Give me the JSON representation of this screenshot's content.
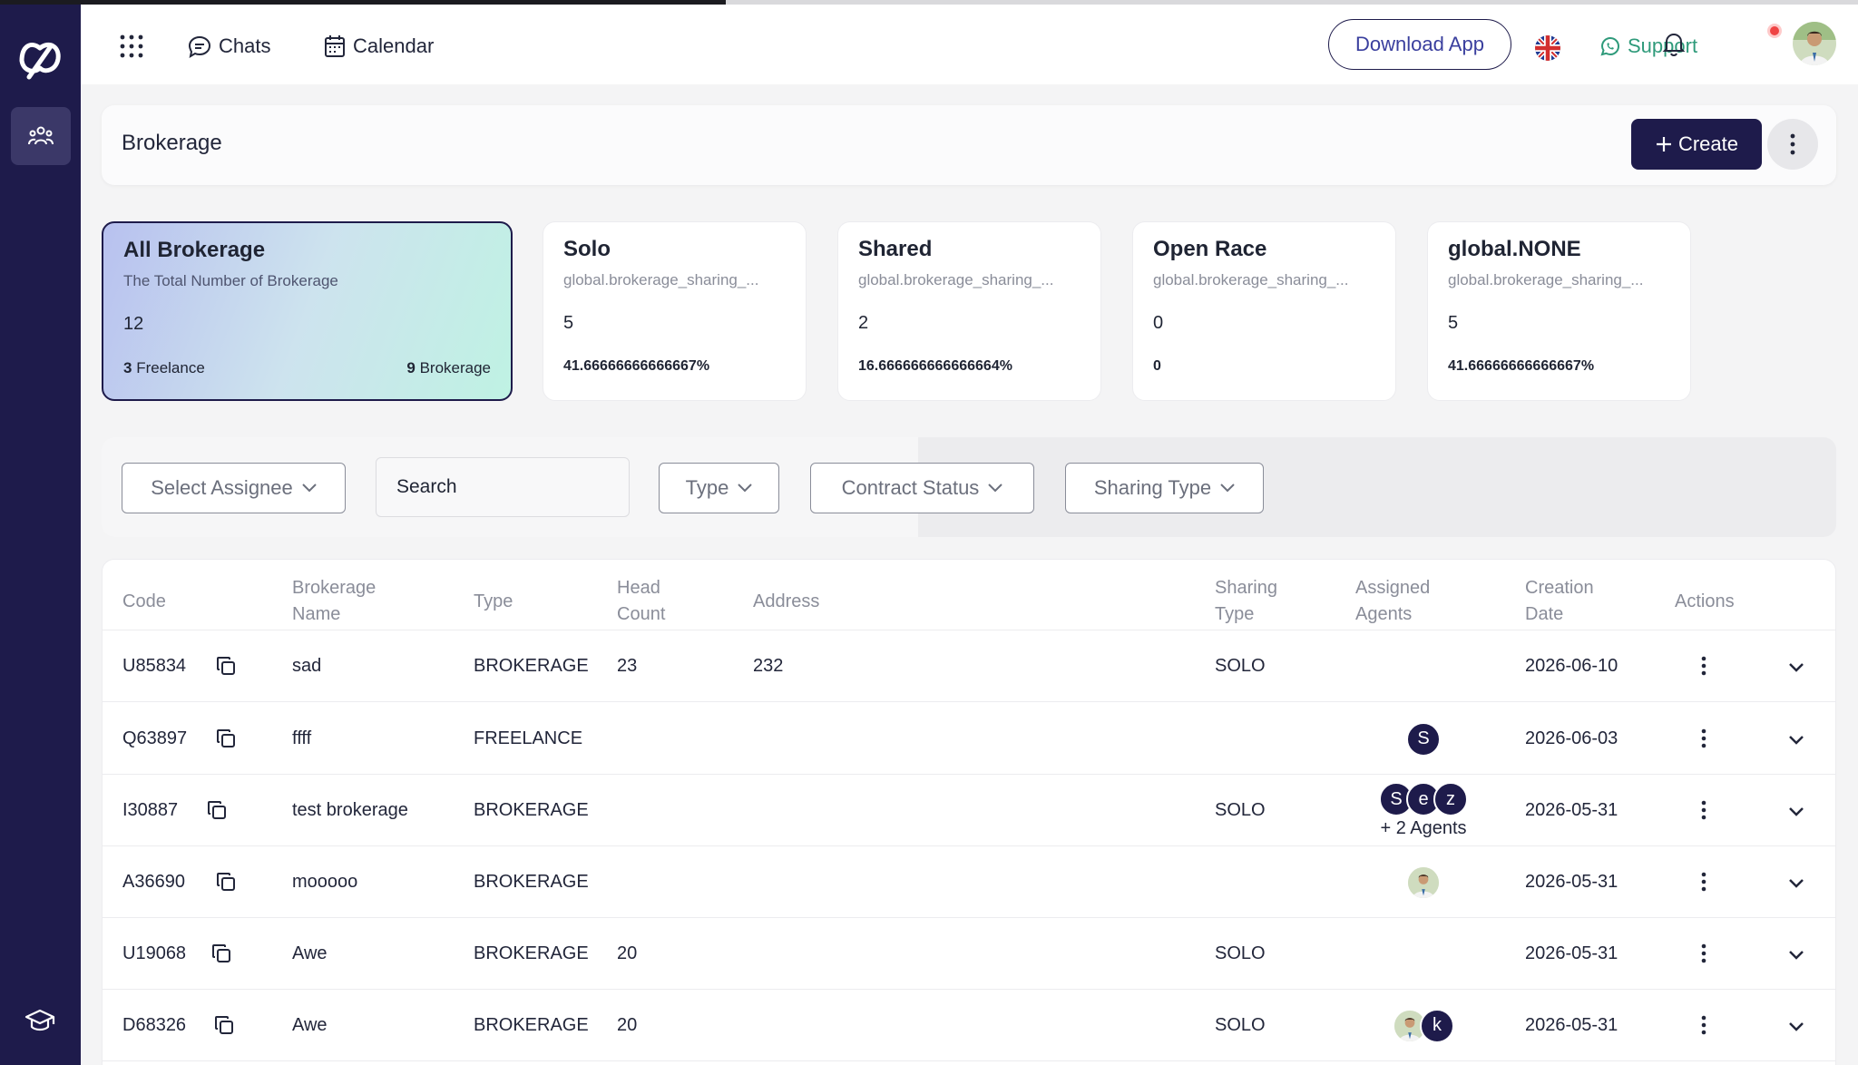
{
  "colors": {
    "sidebar": "#1e1b4b",
    "primary": "#1e1b4b",
    "support": "#2e9a7a",
    "notification": "#ef4444"
  },
  "topnav": {
    "chats_label": "Chats",
    "calendar_label": "Calendar",
    "download_label": "Download App",
    "support_label": "Support"
  },
  "header": {
    "title": "Brokerage",
    "create_label": "Create"
  },
  "stats": {
    "all": {
      "title": "All Brokerage",
      "subtitle": "The Total Number of Brokerage",
      "count": "12",
      "freelance_count": "3",
      "freelance_label": "Freelance",
      "brokerage_count": "9",
      "brokerage_label": "Brokerage"
    },
    "solo": {
      "title": "Solo",
      "subtitle": "global.brokerage_sharing_...",
      "count": "5",
      "percent": "41.66666666666667%"
    },
    "shared": {
      "title": "Shared",
      "subtitle": "global.brokerage_sharing_...",
      "count": "2",
      "percent": "16.666666666666664%"
    },
    "open_race": {
      "title": "Open Race",
      "subtitle": "global.brokerage_sharing_...",
      "count": "0",
      "percent": "0"
    },
    "none": {
      "title": "global.NONE",
      "subtitle": "global.brokerage_sharing_...",
      "count": "5",
      "percent": "41.66666666666667%"
    }
  },
  "filters": {
    "assignee": "Select Assignee",
    "search_placeholder": "Search",
    "type": "Type",
    "contract_status": "Contract Status",
    "sharing_type": "Sharing Type"
  },
  "table": {
    "headers": {
      "code": "Code",
      "name_1": "Brokerage",
      "name_2": "Name",
      "type": "Type",
      "head_1": "Head",
      "head_2": "Count",
      "address": "Address",
      "sharing_1": "Sharing",
      "sharing_2": "Type",
      "agents_1": "Assigned",
      "agents_2": "Agents",
      "date_1": "Creation",
      "date_2": "Date",
      "actions": "Actions"
    },
    "rows": [
      {
        "code": "U85834",
        "name": "sad",
        "type": "BROKERAGE",
        "head_count": "23",
        "address": "232",
        "sharing": "SOLO",
        "date": "2026-06-10"
      },
      {
        "code": "Q63897",
        "name": "ffff",
        "type": "FREELANCE",
        "head_count": "",
        "address": "",
        "sharing": "",
        "agent_1": "S",
        "date": "2026-06-03"
      },
      {
        "code": "I30887",
        "name": "test brokerage",
        "type": "BROKERAGE",
        "head_count": "",
        "address": "",
        "sharing": "SOLO",
        "agent_1": "S",
        "agent_2": "e",
        "agent_3": "z",
        "more_agents": "+ 2 Agents",
        "date": "2026-05-31"
      },
      {
        "code": "A36690",
        "name": "mooooo",
        "type": "BROKERAGE",
        "head_count": "",
        "address": "",
        "sharing": "",
        "date": "2026-05-31"
      },
      {
        "code": "U19068",
        "name": "Awe",
        "type": "BROKERAGE",
        "head_count": "20",
        "address": "",
        "sharing": "SOLO",
        "date": "2026-05-31"
      },
      {
        "code": "D68326",
        "name": "Awe",
        "type": "BROKERAGE",
        "head_count": "20",
        "address": "",
        "sharing": "SOLO",
        "agent_2": "k",
        "date": "2026-05-31"
      }
    ]
  }
}
